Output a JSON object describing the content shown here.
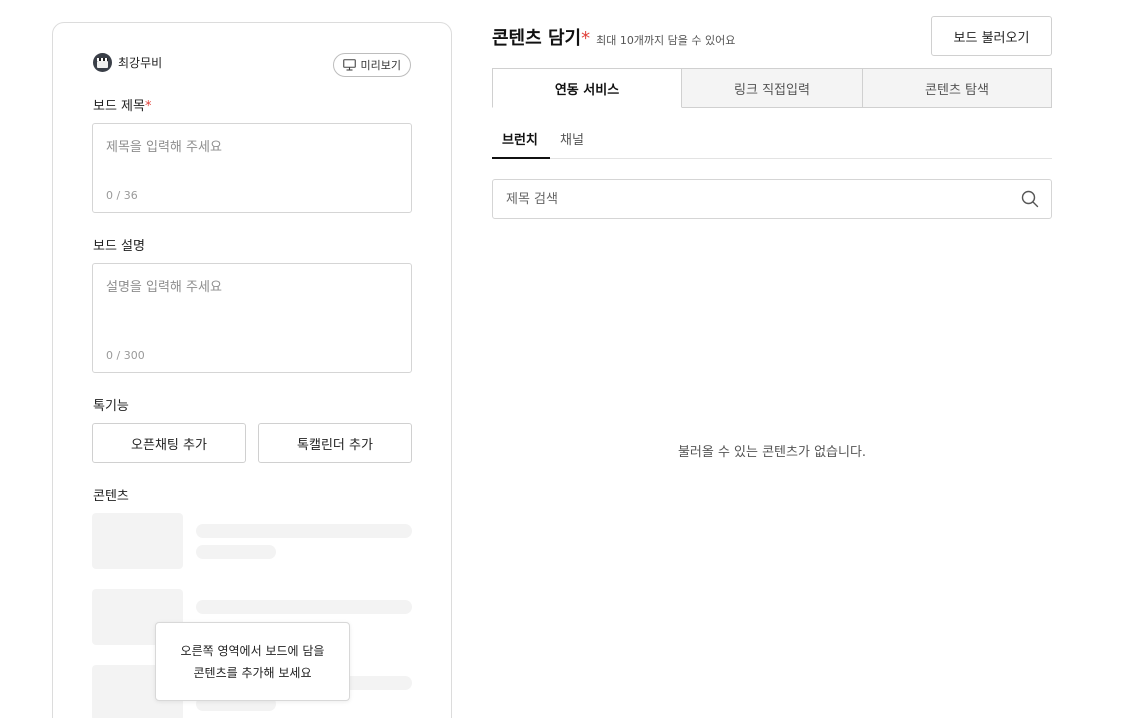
{
  "editor": {
    "author_name": "최강무비",
    "preview_label": "미리보기",
    "title_label": "보드 제목",
    "required_mark": "*",
    "title_placeholder": "제목을 입력해 주세요",
    "title_count": "0 / 36",
    "desc_label": "보드 설명",
    "desc_placeholder": "설명을 입력해 주세요",
    "desc_count": "0 / 300",
    "features_label": "톡기능",
    "open_chat_button": "오픈채팅 추가",
    "calendar_button": "톡캘린더 추가",
    "contents_label": "콘텐츠",
    "tooltip_line1": "오른쪽 영역에서 보드에 담을",
    "tooltip_line2": "콘텐츠를 추가해 보세요"
  },
  "contents": {
    "title": "콘텐츠 담기",
    "required_mark": "*",
    "subtitle": "최대 10개까지 담을 수 있어요",
    "load_board_button": "보드 불러오기",
    "tabs": [
      {
        "label": "연동 서비스",
        "active": true
      },
      {
        "label": "링크 직접입력",
        "active": false
      },
      {
        "label": "콘텐츠 탐색",
        "active": false
      }
    ],
    "subtabs": [
      {
        "label": "브런치",
        "active": true
      },
      {
        "label": "채널",
        "active": false
      }
    ],
    "search_placeholder": "제목 검색",
    "empty_message": "불러올 수 있는 콘텐츠가 없습니다."
  },
  "icons": {
    "preview": "monitor-icon",
    "search": "search-icon",
    "avatar": "clapperboard-avatar"
  },
  "colors": {
    "required": "#e0413a",
    "border": "#d0d0d0",
    "skeleton": "#f3f3f3"
  }
}
